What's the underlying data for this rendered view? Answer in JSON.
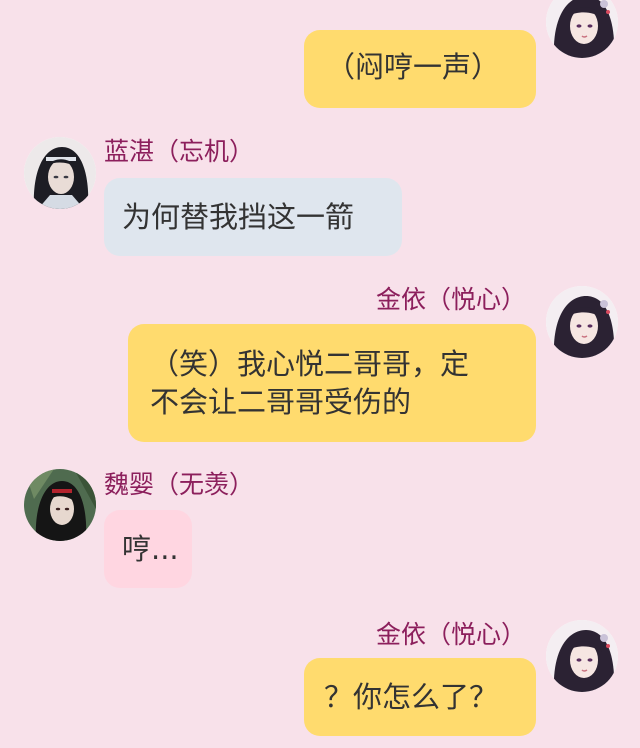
{
  "colors": {
    "background": "#f8e1ea",
    "sender_name": "#8c1f5c",
    "bubble_self": "#ffdb6e",
    "bubble_lanzhan": "#dfe6ee",
    "bubble_weiying": "#ffd6e1",
    "text": "#333333"
  },
  "messages": [
    {
      "sender": "",
      "side": "right",
      "avatar": "female-avatar-icon",
      "text": "（闷哼一声）"
    },
    {
      "sender": "蓝湛（忘机）",
      "side": "left",
      "avatar": "lanzhan-avatar-icon",
      "text": "为何替我挡这一箭"
    },
    {
      "sender": "金依（悦心）",
      "side": "right",
      "avatar": "female-avatar-icon",
      "text_lines": [
        "（笑）我心悦二哥哥，定",
        "不会让二哥哥受伤的"
      ]
    },
    {
      "sender": "魏婴（无羡）",
      "side": "left",
      "avatar": "weiying-avatar-icon",
      "text": "哼..."
    },
    {
      "sender": "金依（悦心）",
      "side": "right",
      "avatar": "female-avatar-icon",
      "text": "？你怎么了？"
    }
  ]
}
